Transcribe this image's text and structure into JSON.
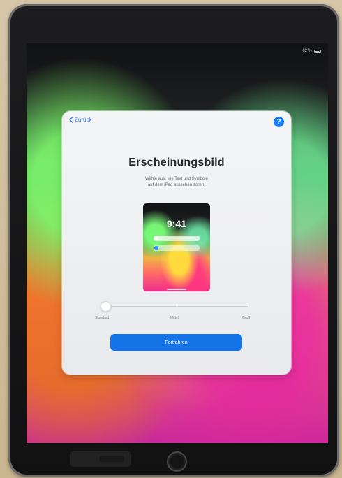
{
  "status_bar": {
    "battery_text": "62 %"
  },
  "dialog": {
    "back_label": "Zurück",
    "help_label": "?",
    "title": "Erscheinungsbild",
    "subtitle": "Wähle aus, wie Text und Symbole\nauf dem iPad aussehen sollen.",
    "preview": {
      "time": "9:41"
    },
    "slider": {
      "labels": [
        "Standard",
        "Mittel",
        "Groß"
      ],
      "selected_index": 0
    },
    "button_label": "Fortfahren"
  },
  "colors": {
    "accent": "#1473e6",
    "link": "#3478f6",
    "help": "#167df3",
    "dialog_bg": "#f2f3f5"
  },
  "icons": {
    "back": "chevron-left-icon",
    "help": "question-mark-icon",
    "battery": "battery-icon",
    "home": "home-button-icon"
  }
}
